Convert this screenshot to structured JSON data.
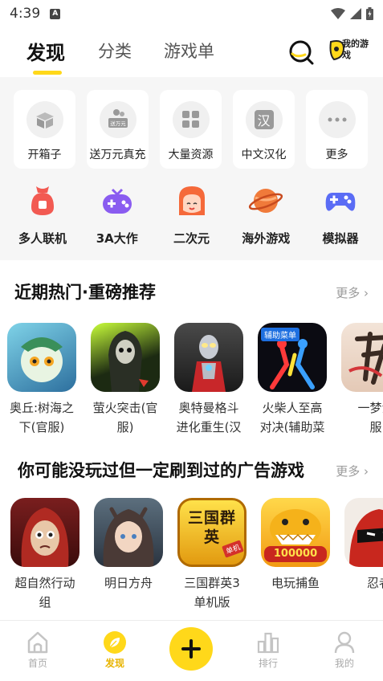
{
  "status_bar": {
    "time": "4:39",
    "a_badge": "A"
  },
  "top_nav": {
    "tabs": [
      {
        "label": "发现",
        "active": true
      },
      {
        "label": "分类",
        "active": false
      },
      {
        "label": "游戏单",
        "active": false
      }
    ],
    "my_games_label": "我的游戏"
  },
  "quick_links": [
    {
      "label": "开箱子",
      "icon": "box-icon"
    },
    {
      "label": "送万元真充",
      "icon": "gift-money-icon",
      "badge": "送万元"
    },
    {
      "label": "大量资源",
      "icon": "grid-icon"
    },
    {
      "label": "中文汉化",
      "icon": "han-icon",
      "glyph": "汉"
    },
    {
      "label": "更多",
      "icon": "more-dots-icon"
    }
  ],
  "categories": [
    {
      "label": "多人联机",
      "icon": "multiplayer-icon",
      "color": "#f25a52"
    },
    {
      "label": "3A大作",
      "icon": "gamepad-3a-icon",
      "color": "#8a5cf0"
    },
    {
      "label": "二次元",
      "icon": "anime-face-icon",
      "color": "#f5693a"
    },
    {
      "label": "海外游戏",
      "icon": "planet-icon",
      "color": "#f07a3a"
    },
    {
      "label": "模拟器",
      "icon": "emulator-gamepad-icon",
      "color": "#5a6cf5"
    }
  ],
  "section_hot": {
    "title": "近期热门·重磅推荐",
    "more": "更多",
    "games": [
      {
        "line1": "奥丘:树海之",
        "line2": "下(官服)"
      },
      {
        "line1": "萤火突击(官",
        "line2": "服)"
      },
      {
        "line1": "奥特曼格斗",
        "line2": "进化重生(汉"
      },
      {
        "line1": "火柴人至高",
        "line2": "对决(辅助菜",
        "icon_text": "辅助菜单"
      },
      {
        "line1": "一梦江",
        "line2": "服"
      }
    ]
  },
  "section_ads": {
    "title": "你可能没玩过但一定刷到过的广告游戏",
    "more": "更多",
    "games": [
      {
        "line1": "超自然行动",
        "line2": "组"
      },
      {
        "line1": "明日方舟",
        "line2": ""
      },
      {
        "line1": "三国群英3",
        "line2": "单机版",
        "icon_text": "三国群英",
        "icon_badge": "单机"
      },
      {
        "line1": "电玩捕鱼",
        "line2": "",
        "icon_text": "100000"
      },
      {
        "line1": "忍者",
        "line2": ""
      }
    ]
  },
  "bottom_nav": [
    {
      "label": "首页",
      "icon": "home-icon",
      "active": false
    },
    {
      "label": "发现",
      "icon": "discover-leaf-icon",
      "active": true
    },
    {
      "label": "",
      "icon": "plus-icon",
      "active": false
    },
    {
      "label": "排行",
      "icon": "ranking-bars-icon",
      "active": false
    },
    {
      "label": "我的",
      "icon": "profile-icon",
      "active": false
    }
  ],
  "colors": {
    "accent": "#ffd81a",
    "active_label": "#e8b400"
  }
}
